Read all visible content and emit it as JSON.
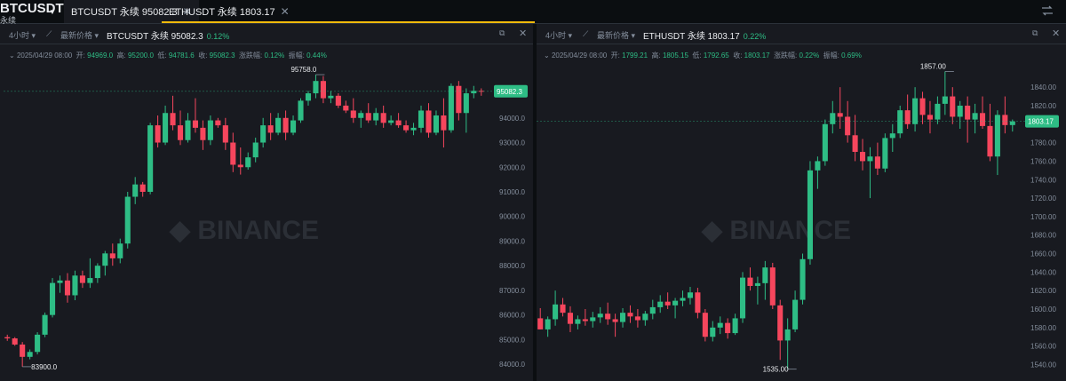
{
  "header": {
    "symbol": "BTCUSDT",
    "symbol_sub": "永续",
    "tabs": [
      {
        "label": "BTCUSDT 永续 95082.3"
      },
      {
        "label": "ETHUSDT 永续 1803.17"
      }
    ]
  },
  "panels": [
    {
      "interval": "4小时",
      "price_type": "最新价格",
      "title": "BTCUSDT 永续 95082.3",
      "change": "0.12%",
      "ohlc": {
        "date": "2025/04/29 08:00",
        "open_label": "开:",
        "open": "94969.0",
        "high_label": "高:",
        "high": "95200.0",
        "low_label": "低:",
        "low": "94781.6",
        "close_label": "收:",
        "close": "95082.3",
        "chg_label": "涨跌幅:",
        "chg": "0.12%",
        "amp_label": "振幅:",
        "amp": "0.44%"
      },
      "watermark": "BINANCE",
      "last_price": "95082.3",
      "high_marker": "95758.0",
      "low_marker": "83900.0",
      "y_ticks": [
        "94000.0",
        "93000.0",
        "92000.0",
        "91000.0",
        "90000.0",
        "89000.0",
        "88000.0",
        "87000.0",
        "86000.0",
        "85000.0",
        "84000.0"
      ]
    },
    {
      "interval": "4小时",
      "price_type": "最新价格",
      "title": "ETHUSDT 永续 1803.17",
      "change": "0.22%",
      "ohlc": {
        "date": "2025/04/29 08:00",
        "open_label": "开:",
        "open": "1799.21",
        "high_label": "高:",
        "high": "1805.15",
        "low_label": "低:",
        "low": "1792.65",
        "close_label": "收:",
        "close": "1803.17",
        "chg_label": "涨跌幅:",
        "chg": "0.22%",
        "amp_label": "振幅:",
        "amp": "0.69%"
      },
      "watermark": "BINANCE",
      "last_price": "1803.17",
      "high_marker": "1857.00",
      "low_marker": "1535.00",
      "y_ticks": [
        "1840.00",
        "1820.00",
        "1800.00",
        "1780.00",
        "1760.00",
        "1740.00",
        "1720.00",
        "1700.00",
        "1680.00",
        "1660.00",
        "1640.00",
        "1620.00",
        "1600.00",
        "1580.00",
        "1560.00",
        "1540.00"
      ]
    }
  ],
  "colors": {
    "up": "#2ebd85",
    "down": "#f6465d",
    "accent": "#f0b90b"
  },
  "chart_data": [
    {
      "type": "candlestick",
      "title": "BTCUSDT 永续",
      "candles": [
        [
          85100,
          85200,
          84950,
          85050
        ],
        [
          85050,
          85100,
          84750,
          84800
        ],
        [
          84800,
          84900,
          83900,
          84300
        ],
        [
          84300,
          84600,
          84200,
          84500
        ],
        [
          84500,
          85300,
          84400,
          85200
        ],
        [
          85200,
          86100,
          85100,
          86000
        ],
        [
          86000,
          87500,
          85900,
          87300
        ],
        [
          87300,
          87600,
          86900,
          87400
        ],
        [
          87400,
          87700,
          86500,
          86800
        ],
        [
          86800,
          87800,
          86600,
          87600
        ],
        [
          87600,
          87800,
          87100,
          87300
        ],
        [
          87300,
          88300,
          87100,
          87500
        ],
        [
          87500,
          88100,
          87300,
          88000
        ],
        [
          88000,
          88600,
          87600,
          88500
        ],
        [
          88500,
          88900,
          88000,
          88300
        ],
        [
          88300,
          89100,
          88100,
          88900
        ],
        [
          88900,
          91000,
          88700,
          90800
        ],
        [
          90800,
          91600,
          90500,
          91300
        ],
        [
          91300,
          91400,
          90800,
          91000
        ],
        [
          91000,
          93800,
          90900,
          93700
        ],
        [
          93700,
          94100,
          92800,
          93000
        ],
        [
          93000,
          94500,
          92900,
          94200
        ],
        [
          94200,
          94900,
          93500,
          93700
        ],
        [
          93700,
          94300,
          92900,
          93100
        ],
        [
          93100,
          94200,
          93000,
          93900
        ],
        [
          93900,
          94800,
          93400,
          93600
        ],
        [
          93600,
          93900,
          92700,
          93100
        ],
        [
          93100,
          94100,
          92900,
          93900
        ],
        [
          93900,
          94000,
          93600,
          93700
        ],
        [
          93700,
          94000,
          92700,
          93000
        ],
        [
          93000,
          93400,
          91800,
          92100
        ],
        [
          92100,
          92800,
          91700,
          92000
        ],
        [
          92000,
          92600,
          91900,
          92400
        ],
        [
          92400,
          93200,
          92200,
          93000
        ],
        [
          93000,
          94000,
          92800,
          93700
        ],
        [
          93700,
          94200,
          93100,
          93400
        ],
        [
          93400,
          94200,
          93300,
          94000
        ],
        [
          94000,
          94300,
          93100,
          93400
        ],
        [
          93400,
          94100,
          93300,
          93900
        ],
        [
          93900,
          94800,
          93800,
          94700
        ],
        [
          94700,
          95100,
          94500,
          95000
        ],
        [
          95000,
          95758,
          94800,
          95500
        ],
        [
          95500,
          95700,
          94600,
          94800
        ],
        [
          94800,
          95100,
          94600,
          94900
        ],
        [
          94900,
          95000,
          94400,
          94500
        ],
        [
          94500,
          94700,
          94200,
          94300
        ],
        [
          94300,
          94800,
          93800,
          94000
        ],
        [
          94000,
          94300,
          93600,
          94200
        ],
        [
          94200,
          94600,
          93800,
          93900
        ],
        [
          93900,
          94400,
          93700,
          94200
        ],
        [
          94200,
          94500,
          93600,
          93800
        ],
        [
          93800,
          94100,
          93700,
          93900
        ],
        [
          93900,
          94200,
          93600,
          93700
        ],
        [
          93700,
          93900,
          93400,
          93500
        ],
        [
          93500,
          93800,
          93300,
          93600
        ],
        [
          93600,
          94500,
          93400,
          94300
        ],
        [
          94300,
          94600,
          93200,
          93400
        ],
        [
          93400,
          94300,
          93300,
          94100
        ],
        [
          94100,
          94800,
          92800,
          93500
        ],
        [
          93500,
          95400,
          93400,
          95300
        ],
        [
          95300,
          95500,
          93900,
          94200
        ],
        [
          94200,
          95200,
          93400,
          95000
        ],
        [
          95000,
          95300,
          94800,
          95100
        ],
        [
          95100,
          95200,
          94900,
          95082
        ]
      ],
      "ylim": [
        83500,
        96300
      ]
    },
    {
      "type": "candlestick",
      "title": "ETHUSDT 永续",
      "candles": [
        [
          1590,
          1601,
          1578,
          1578
        ],
        [
          1578,
          1592,
          1570,
          1589
        ],
        [
          1589,
          1620,
          1582,
          1605
        ],
        [
          1605,
          1612,
          1592,
          1596
        ],
        [
          1596,
          1603,
          1575,
          1584
        ],
        [
          1584,
          1593,
          1578,
          1589
        ],
        [
          1589,
          1600,
          1582,
          1587
        ],
        [
          1587,
          1597,
          1580,
          1591
        ],
        [
          1591,
          1602,
          1585,
          1595
        ],
        [
          1595,
          1607,
          1583,
          1589
        ],
        [
          1589,
          1595,
          1570,
          1586
        ],
        [
          1586,
          1601,
          1580,
          1596
        ],
        [
          1596,
          1604,
          1585,
          1592
        ],
        [
          1592,
          1600,
          1580,
          1588
        ],
        [
          1588,
          1598,
          1582,
          1595
        ],
        [
          1595,
          1610,
          1589,
          1602
        ],
        [
          1602,
          1615,
          1596,
          1608
        ],
        [
          1608,
          1618,
          1600,
          1604
        ],
        [
          1604,
          1612,
          1590,
          1609
        ],
        [
          1609,
          1620,
          1603,
          1612
        ],
        [
          1612,
          1624,
          1605,
          1618
        ],
        [
          1618,
          1623,
          1590,
          1596
        ],
        [
          1596,
          1600,
          1565,
          1570
        ],
        [
          1570,
          1587,
          1565,
          1580
        ],
        [
          1580,
          1592,
          1573,
          1585
        ],
        [
          1585,
          1590,
          1568,
          1574
        ],
        [
          1574,
          1595,
          1572,
          1590
        ],
        [
          1590,
          1640,
          1585,
          1634
        ],
        [
          1634,
          1645,
          1620,
          1625
        ],
        [
          1625,
          1635,
          1605,
          1628
        ],
        [
          1628,
          1652,
          1610,
          1645
        ],
        [
          1645,
          1650,
          1600,
          1604
        ],
        [
          1604,
          1610,
          1545,
          1566
        ],
        [
          1566,
          1590,
          1535,
          1578
        ],
        [
          1578,
          1620,
          1575,
          1610
        ],
        [
          1610,
          1660,
          1605,
          1654
        ],
        [
          1654,
          1760,
          1648,
          1750
        ],
        [
          1750,
          1765,
          1730,
          1760
        ],
        [
          1760,
          1805,
          1755,
          1800
        ],
        [
          1800,
          1825,
          1790,
          1812
        ],
        [
          1812,
          1840,
          1795,
          1808
        ],
        [
          1808,
          1825,
          1780,
          1788
        ],
        [
          1788,
          1810,
          1760,
          1770
        ],
        [
          1770,
          1784,
          1750,
          1760
        ],
        [
          1760,
          1775,
          1720,
          1765
        ],
        [
          1765,
          1780,
          1745,
          1752
        ],
        [
          1752,
          1790,
          1748,
          1785
        ],
        [
          1785,
          1800,
          1770,
          1790
        ],
        [
          1790,
          1820,
          1785,
          1815
        ],
        [
          1815,
          1832,
          1795,
          1800
        ],
        [
          1800,
          1840,
          1792,
          1828
        ],
        [
          1828,
          1835,
          1800,
          1810
        ],
        [
          1810,
          1825,
          1790,
          1805
        ],
        [
          1805,
          1830,
          1800,
          1822
        ],
        [
          1822,
          1857,
          1810,
          1830
        ],
        [
          1830,
          1840,
          1800,
          1808
        ],
        [
          1808,
          1825,
          1795,
          1820
        ],
        [
          1820,
          1830,
          1780,
          1805
        ],
        [
          1805,
          1822,
          1790,
          1812
        ],
        [
          1812,
          1830,
          1795,
          1798
        ],
        [
          1798,
          1822,
          1760,
          1765
        ],
        [
          1765,
          1815,
          1745,
          1810
        ],
        [
          1810,
          1830,
          1790,
          1799
        ],
        [
          1799,
          1805,
          1792,
          1803
        ]
      ],
      "ylim": [
        1527,
        1868
      ]
    }
  ]
}
